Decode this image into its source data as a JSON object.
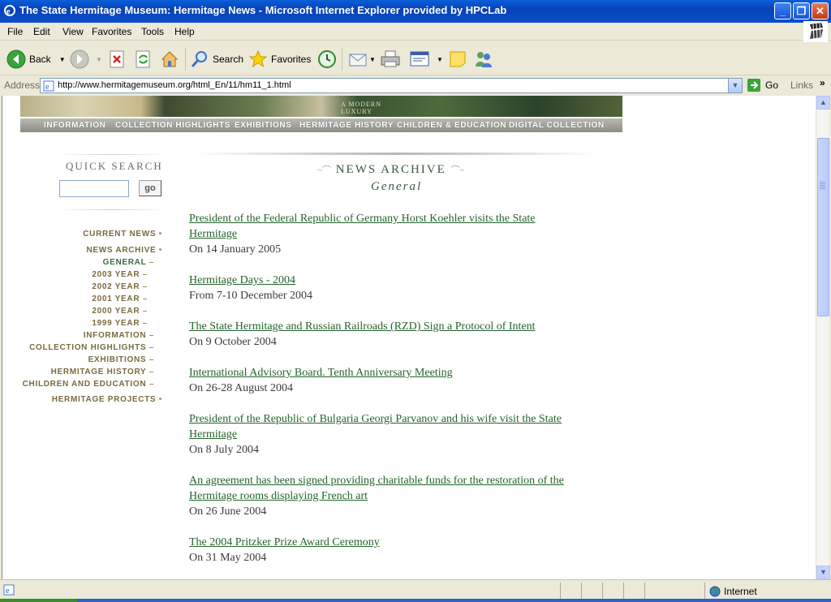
{
  "window": {
    "title": "The State Hermitage Museum: Hermitage News - Microsoft Internet Explorer provided by HPCLab",
    "minimize_glyph": "_",
    "maximize_glyph": "❐",
    "close_glyph": "✕"
  },
  "menu": [
    "File",
    "Edit",
    "View",
    "Favorites",
    "Tools",
    "Help"
  ],
  "toolbar": {
    "back_label": "Back",
    "search_label": "Search",
    "favorites_label": "Favorites"
  },
  "address": {
    "label": "Address",
    "url": "http://www.hermitagemuseum.org/html_En/11/hm11_1.html",
    "go_label": "Go",
    "links_label": "Links",
    "links_chevron": "»"
  },
  "site": {
    "banner_text": [
      "A MODERN",
      "LUXURY"
    ],
    "top_nav": [
      "INFORMATION",
      "COLLECTION HIGHLIGHTS",
      "EXHIBITIONS",
      "HERMITAGE HISTORY",
      "CHILDREN & EDUCATION",
      "DIGITAL COLLECTION"
    ],
    "quick_search": {
      "title": "QUICK SEARCH",
      "go_label": "go",
      "value": ""
    },
    "left_nav": [
      {
        "label": "CURRENT NEWS",
        "bullet": "•"
      },
      {
        "label": "NEWS ARCHIVE",
        "bullet": "•"
      },
      {
        "label": "GENERAL",
        "bullet": "–"
      },
      {
        "label": "2003 YEAR",
        "bullet": "–"
      },
      {
        "label": "2002 YEAR",
        "bullet": "–"
      },
      {
        "label": "2001 YEAR",
        "bullet": "–"
      },
      {
        "label": "2000 YEAR",
        "bullet": "–"
      },
      {
        "label": "1999 YEAR",
        "bullet": "–"
      },
      {
        "label": "INFORMATION",
        "bullet": "–"
      },
      {
        "label": "COLLECTION HIGHLIGHTS",
        "bullet": "–"
      },
      {
        "label": "EXHIBITIONS",
        "bullet": "–"
      },
      {
        "label": "HERMITAGE HISTORY",
        "bullet": "–"
      },
      {
        "label": "CHILDREN AND EDUCATION",
        "bullet": "–"
      },
      {
        "label": "HERMITAGE PROJECTS",
        "bullet": "•"
      }
    ],
    "archive_title": "NEWS ARCHIVE",
    "archive_sub": "General",
    "news": [
      {
        "lines": [
          "President of the Federal Republic of Germany Horst Koehler visits the State",
          "Hermitage"
        ],
        "date": "On 14 January 2005"
      },
      {
        "lines": [
          "Hermitage Days - 2004"
        ],
        "date": "From 7-10 December 2004"
      },
      {
        "lines": [
          "The State Hermitage and Russian Railroads (RZD) Sign a Protocol of Intent"
        ],
        "date": "On 9 October 2004"
      },
      {
        "lines": [
          "International Advisory Board. Tenth Anniversary Meeting"
        ],
        "date": "On 26-28 August 2004"
      },
      {
        "lines": [
          "President of the Republic of Bulgaria Georgi Parvanov and his wife visit the State",
          "Hermitage"
        ],
        "date": "On 8 July 2004"
      },
      {
        "lines": [
          "An agreement has been signed providing charitable funds for the restoration of the",
          "Hermitage rooms displaying French art"
        ],
        "date": "On 26 June 2004"
      },
      {
        "lines": [
          "The 2004 Pritzker Prize Award Ceremony"
        ],
        "date": "On 31 May 2004"
      }
    ]
  },
  "status": {
    "zone": "Internet"
  }
}
